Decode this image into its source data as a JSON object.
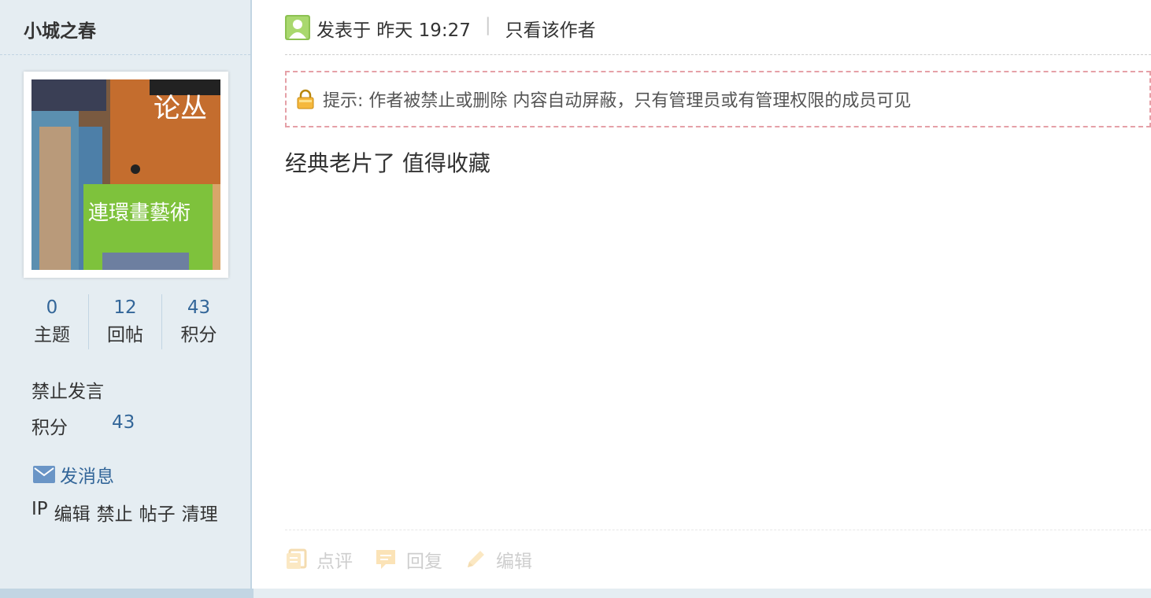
{
  "sidebar": {
    "username": "小城之春",
    "stats": [
      {
        "value": "0",
        "label": "主题"
      },
      {
        "value": "12",
        "label": "回帖"
      },
      {
        "value": "43",
        "label": "积分"
      }
    ],
    "group": "禁止发言",
    "credits_label": "积分",
    "credits_value": "43",
    "message_link": "发消息",
    "admin_links": [
      "IP",
      "编辑",
      "禁止",
      "帖子",
      "清理"
    ]
  },
  "post": {
    "posted_label": "发表于 昨天 19:27",
    "separator": "|",
    "only_author": "只看该作者",
    "notice": "提示: 作者被禁止或删除 内容自动屏蔽，只有管理员或有管理权限的成员可见",
    "body": "经典老片了 值得收藏"
  },
  "actions": {
    "comment": "点评",
    "reply": "回复",
    "edit": "编辑"
  },
  "colors": {
    "link": "#336699",
    "sidebar_bg": "#e5edf2",
    "border": "#c2d5e3",
    "notice_border": "#e5a0a7"
  }
}
